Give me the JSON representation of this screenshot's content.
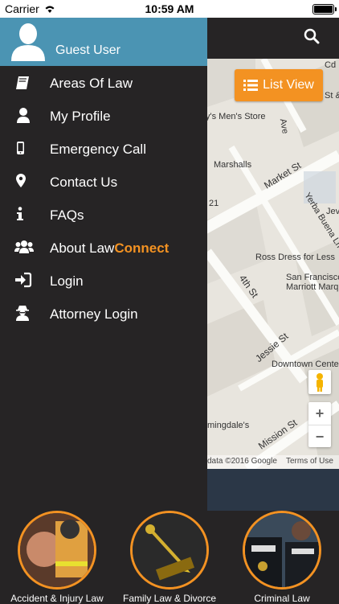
{
  "status_bar": {
    "carrier": "Carrier",
    "time": "10:59 AM"
  },
  "header": {
    "search_icon": "search-icon"
  },
  "drawer": {
    "user_name": "Guest User",
    "menu": [
      {
        "label": "Areas Of Law",
        "icon": "book-icon"
      },
      {
        "label": "My Profile",
        "icon": "user-icon"
      },
      {
        "label": "Emergency Call",
        "icon": "mobile-phone-icon"
      },
      {
        "label": "Contact Us",
        "icon": "map-marker-icon"
      },
      {
        "label": "FAQs",
        "icon": "info-icon"
      },
      {
        "label_prefix": "About Law",
        "label_accent": "Connect",
        "icon": "users-group-icon"
      },
      {
        "label": "Login",
        "icon": "sign-in-icon"
      },
      {
        "label": "Attorney Login",
        "icon": "user-secret-icon"
      }
    ]
  },
  "map": {
    "list_view_label": "List View",
    "labels": {
      "mens_store": "y's Men's Store",
      "ave": "Ave",
      "marshalls": "Marshalls",
      "market_st": "Market St",
      "yerba_buena": "Yerba Buena Ln",
      "num_21": "21",
      "ross": "Ross Dress for Less",
      "fourth_st": "4th St",
      "sf_marriott_1": "San Francisco",
      "sf_marriott_2": "Marriott Marquis",
      "jessie_st": "Jessie St",
      "downtown_center": "Downtown Center",
      "bloomingdales": "mingdale's",
      "mission_st": "Mission St",
      "cd": "Cd",
      "jev": "Jev",
      "st_and": "St &"
    },
    "zoom_in": "+",
    "zoom_out": "−",
    "footer_data": "data ©2016 Google",
    "footer_terms": "Terms of Use"
  },
  "categories": [
    {
      "label": "Accident & Injury Law"
    },
    {
      "label": "Family Law & Divorce"
    },
    {
      "label": "Criminal Law"
    }
  ],
  "colors": {
    "accent": "#f39222",
    "header_blue": "#4b94b3",
    "background": "#262425"
  }
}
